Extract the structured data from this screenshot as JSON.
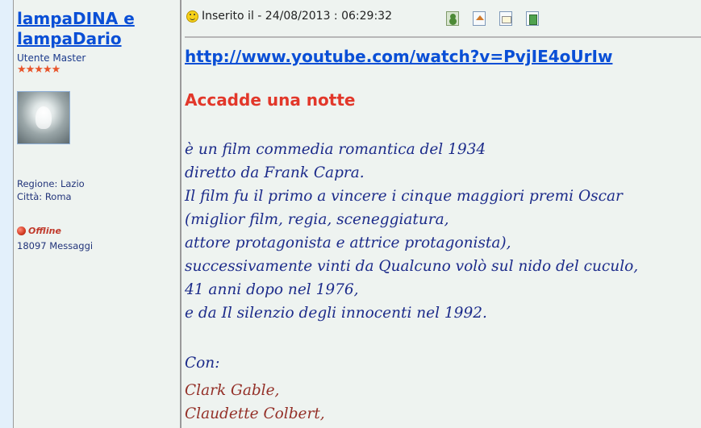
{
  "author": {
    "name": "lampaDINA e lampaDario",
    "rank": "Utente Master",
    "stars": "★★★★★",
    "region": "Regione: Lazio",
    "city": "Città: Roma",
    "status": "Offline",
    "messages": "18097 Messaggi"
  },
  "post": {
    "posted_label": "Inserito il - 24/08/2013 : 06:29:32",
    "toolbar_icons": [
      "profile-icon",
      "home-icon",
      "email-icon",
      "edit-icon"
    ],
    "link": "http://www.youtube.com/watch?v=PvjIE4oUrIw",
    "title": "Accadde una notte",
    "lines": [
      "è un film commedia romantica del 1934",
      "diretto da Frank Capra.",
      "Il film fu il primo a vincere i cinque maggiori premi Oscar",
      "(miglior film, regia, sceneggiatura,",
      "attore protagonista e attrice protagonista),",
      "successivamente vinti da Qualcuno volò sul nido del cuculo,",
      "41 anni dopo nel 1976,",
      "e da Il silenzio degli innocenti nel 1992."
    ],
    "con_label": "Con:",
    "cast": [
      "Clark Gable,",
      "Claudette Colbert,"
    ]
  },
  "colors": {
    "link": "#0a4fd6",
    "title": "#e2372a",
    "body_text": "#1c2b8a",
    "cast_text": "#943028",
    "background": "#eef3f0"
  }
}
